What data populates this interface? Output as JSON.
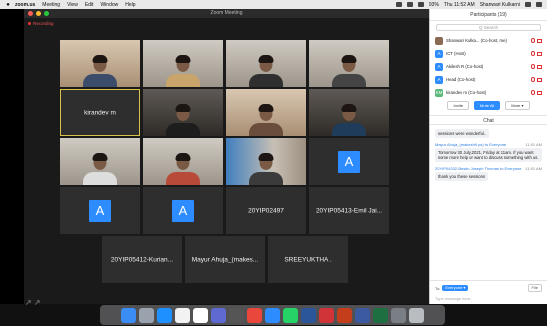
{
  "menubar": {
    "app": "zoom.us",
    "items": [
      "Meeting",
      "View",
      "Edit",
      "Window",
      "Help"
    ],
    "battery": "93%",
    "clock": "Thu 11:52 AM",
    "user": "Shanwari Kulkarni"
  },
  "window": {
    "title": "Zoom Meeting",
    "recording": "Recording"
  },
  "tiles": [
    {
      "kind": "video",
      "name": ""
    },
    {
      "kind": "video",
      "name": ""
    },
    {
      "kind": "video",
      "name": ""
    },
    {
      "kind": "video",
      "name": ""
    },
    {
      "kind": "name",
      "name": "kirandev m"
    },
    {
      "kind": "video",
      "name": ""
    },
    {
      "kind": "video",
      "name": ""
    },
    {
      "kind": "video",
      "name": ""
    },
    {
      "kind": "video",
      "name": ""
    },
    {
      "kind": "video",
      "name": ""
    },
    {
      "kind": "video",
      "name": ""
    },
    {
      "kind": "avatar",
      "name": "",
      "letter": "A"
    },
    {
      "kind": "avatar",
      "name": "",
      "letter": "A"
    },
    {
      "kind": "avatar",
      "name": "",
      "letter": "A"
    },
    {
      "kind": "name",
      "name": "20YIP02497"
    },
    {
      "kind": "name",
      "name": "20YIP05413-Emil Jai..."
    },
    {
      "kind": "name",
      "name": "20YIP05412-Kurian..."
    },
    {
      "kind": "name",
      "name": "Mayur Ahuja_(makes..."
    },
    {
      "kind": "name",
      "name": "SREEYUKTHA ."
    }
  ],
  "participants": {
    "title": "Participants (19)",
    "search_placeholder": "Q Search",
    "list": [
      {
        "name": "Shanwari Kulka... (Co-host, me)",
        "avatar": ""
      },
      {
        "name": "ICT (Host)",
        "avatar": "A"
      },
      {
        "name": "Akilesh R (Co-host)",
        "avatar": "A"
      },
      {
        "name": "Head (Co-host)",
        "avatar": "A"
      },
      {
        "name": "kirandev m (Co-host)",
        "avatar": "KM"
      }
    ],
    "buttons": {
      "invite": "Invite",
      "mute_all": "Mute All",
      "more": "More ▾"
    }
  },
  "chat": {
    "title": "Chat",
    "messages": [
      {
        "from": "",
        "time": "",
        "text": "sessions were wonderful.."
      },
      {
        "from": "Mayur Ahuja_(makesh9 ps) to Everyone",
        "time": "11:51 AM",
        "text": "Tomorrow 30 July,2021, Friday at 11am. If you want some more help or want to discuss something with us."
      },
      {
        "from": "20YIP04332-Bestin Joseph Thomas to Everyone",
        "time": "11:51 AM",
        "text": "thank you these sessions"
      }
    ],
    "to_label": "To:",
    "to_value": "Everyone ▾",
    "file_button": "File",
    "input_placeholder": "Type message here..."
  },
  "colors": {
    "zoom_blue": "#2d8cff",
    "active_speaker": "#d8c14a",
    "stage": "#1a1a1a"
  }
}
